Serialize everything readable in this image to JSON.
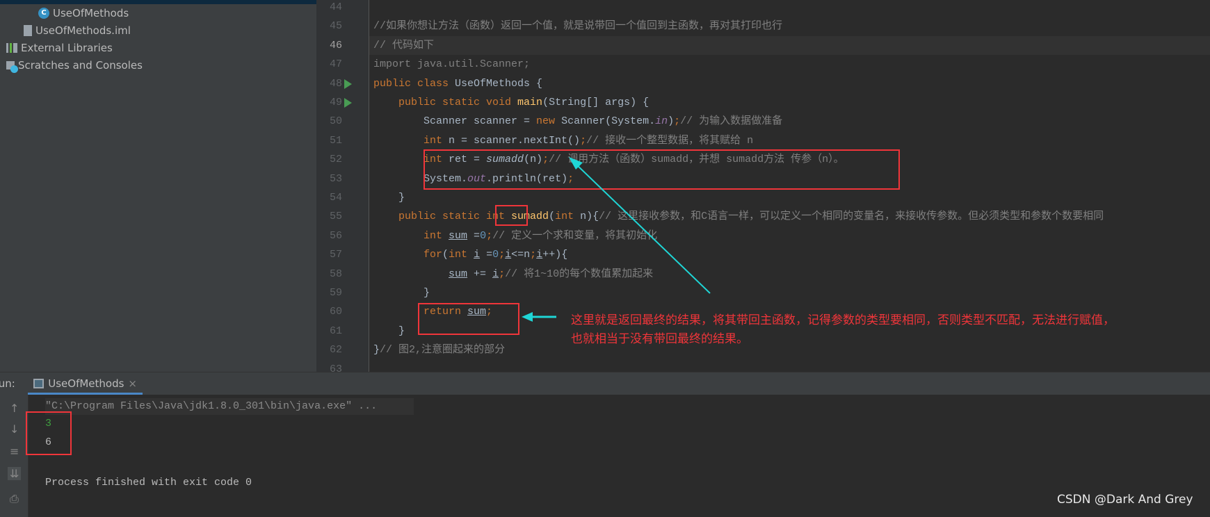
{
  "sidebar": {
    "items": [
      {
        "label": "UseOfMethods",
        "icon": "java-class-icon"
      },
      {
        "label": "UseOfMethods.iml",
        "icon": "iml-file-icon"
      },
      {
        "label": "External Libraries",
        "icon": "library-icon"
      },
      {
        "label": "Scratches and Consoles",
        "icon": "scratches-icon"
      }
    ]
  },
  "editor": {
    "first_line": 44,
    "current_line": 46,
    "run_lines": [
      48,
      49
    ],
    "lines": [
      [],
      [
        [
          "cm",
          "//如果你想让方法（函数）返回一个值，就是说带回一个值回到主函数，再对其打印也行"
        ]
      ],
      [
        [
          "cm",
          "// 代码如下"
        ]
      ],
      [
        [
          "gr",
          "import java.util.Scanner;"
        ]
      ],
      [
        [
          "kw",
          "public class "
        ],
        [
          "",
          "UseOfMethods {"
        ]
      ],
      [
        [
          "",
          "    "
        ],
        [
          "kw",
          "public static void "
        ],
        [
          "mt",
          "main"
        ],
        [
          "",
          "(String[] args) {"
        ]
      ],
      [
        [
          "",
          "        Scanner scanner = "
        ],
        [
          "kw",
          "new "
        ],
        [
          "",
          "Scanner(System."
        ],
        [
          "st",
          "in"
        ],
        [
          "",
          ")"
        ],
        [
          "kw",
          ";"
        ],
        [
          "cm",
          "// 为输入数据做准备"
        ]
      ],
      [
        [
          "",
          "        "
        ],
        [
          "kw",
          "int "
        ],
        [
          "",
          "n = scanner.nextInt()"
        ],
        [
          "kw",
          ";"
        ],
        [
          "cm",
          "// 接收一个整型数据，将其赋给 n"
        ]
      ],
      [
        [
          "",
          "        "
        ],
        [
          "kw",
          "int "
        ],
        [
          "",
          "ret = "
        ],
        [
          "it",
          "sumadd"
        ],
        [
          "",
          "(n)"
        ],
        [
          "kw",
          ";"
        ],
        [
          "cm",
          "// 调用方法（函数）sumadd，并想 sumadd方法 传参（n）。"
        ]
      ],
      [
        [
          "",
          "        System."
        ],
        [
          "st",
          "out"
        ],
        [
          "",
          ".println(ret)"
        ],
        [
          "kw",
          ";"
        ]
      ],
      [
        [
          "",
          "    }"
        ]
      ],
      [
        [
          "",
          "    "
        ],
        [
          "kw",
          "public static int "
        ],
        [
          "mt",
          "sumadd"
        ],
        [
          "",
          "("
        ],
        [
          "kw",
          "int "
        ],
        [
          "",
          "n){"
        ],
        [
          "cm",
          "// 这里接收参数，和C语言一样，可以定义一个相同的变量名，来接收传参数。但必须类型和参数个数要相同"
        ]
      ],
      [
        [
          "",
          "        "
        ],
        [
          "kw",
          "int "
        ],
        [
          "u",
          "sum"
        ],
        [
          "",
          " ="
        ],
        [
          "num",
          "0"
        ],
        [
          "kw",
          ";"
        ],
        [
          "cm",
          "// 定义一个求和变量，将其初始化"
        ]
      ],
      [
        [
          "",
          "        "
        ],
        [
          "kw",
          "for"
        ],
        [
          "",
          "("
        ],
        [
          "kw",
          "int "
        ],
        [
          "u",
          "i"
        ],
        [
          "",
          " ="
        ],
        [
          "num",
          "0"
        ],
        [
          "kw",
          ";"
        ],
        [
          "u",
          "i"
        ],
        [
          "",
          "<=n"
        ],
        [
          "kw",
          ";"
        ],
        [
          "u",
          "i"
        ],
        [
          "",
          "++){"
        ]
      ],
      [
        [
          "",
          "            "
        ],
        [
          "u",
          "sum"
        ],
        [
          "",
          " += "
        ],
        [
          "u",
          "i"
        ],
        [
          "kw",
          ";"
        ],
        [
          "cm",
          "// 将1~10的每个数值累加起来"
        ]
      ],
      [
        [
          "",
          "        }"
        ]
      ],
      [
        [
          "",
          "        "
        ],
        [
          "kw",
          "return "
        ],
        [
          "u",
          "sum"
        ],
        [
          "kw",
          ";"
        ]
      ],
      [
        [
          "",
          "    }"
        ]
      ],
      [
        [
          "",
          "}"
        ],
        [
          "cm",
          "// 图2,注意圈起来的部分"
        ]
      ],
      []
    ]
  },
  "annotation": {
    "line1": "这里就是返回最终的结果，将其带回主函数，记得参数的类型要相同，否则类型不匹配，无法进行赋值，",
    "line2": "也就相当于没有带回最终的结果。"
  },
  "run": {
    "label": "Run:",
    "tab": "UseOfMethods",
    "console": {
      "command": "\"C:\\Program Files\\Java\\jdk1.8.0_301\\bin\\java.exe\" ...",
      "input": "3",
      "output": "6",
      "exit": "Process finished with exit code 0"
    }
  },
  "watermark": "CSDN @Dark And Grey",
  "colors": {
    "highlight_box": "#f0353a",
    "arrow": "#1fd6d6"
  }
}
